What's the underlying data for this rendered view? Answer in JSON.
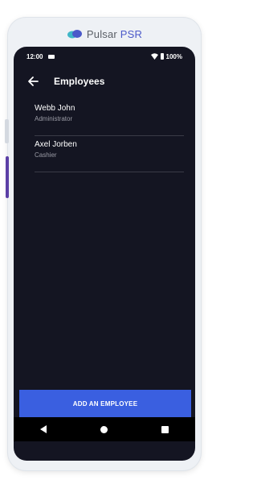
{
  "brand": {
    "name_main": "Pulsar ",
    "name_accent": "PSR",
    "logo_icon": "pulsar-cloud-logo-icon"
  },
  "statusbar": {
    "time": "12:00",
    "battery": "100%"
  },
  "appbar": {
    "title": "Employees",
    "back_icon": "arrow-left-icon"
  },
  "employees": [
    {
      "name": "Webb John",
      "role": "Administrator"
    },
    {
      "name": "Axel Jorben",
      "role": "Cashier"
    }
  ],
  "actions": {
    "add_employee": "ADD AN EMPLOYEE"
  },
  "navbar": {
    "back_icon": "triangle-back-icon",
    "home_icon": "circle-home-icon",
    "recent_icon": "square-recent-icon"
  },
  "colors": {
    "screen_bg": "#141522",
    "primary_button": "#3a5fe0",
    "brand_accent": "#4b59c9"
  }
}
